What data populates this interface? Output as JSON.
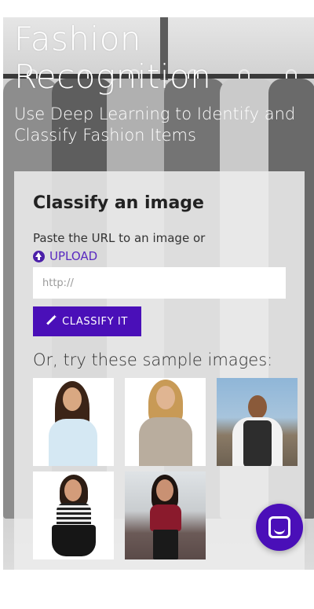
{
  "header": {
    "title": "Fashion Recognition",
    "subtitle": "Use Deep Learning to Identify and Classify Fashion Items"
  },
  "card": {
    "title": "Classify an image",
    "paste_text": "Paste the URL to an image or",
    "upload_label": "UPLOAD",
    "url_placeholder": "http://",
    "url_value": "",
    "classify_label": "CLASSIFY IT",
    "samples_heading": "Or, try these sample images:"
  },
  "samples": [
    {
      "name": "woman-white-wrap-top"
    },
    {
      "name": "woman-beige-sweater"
    },
    {
      "name": "man-vest-sunglasses"
    },
    {
      "name": "woman-striped-top-black-skirt"
    },
    {
      "name": "woman-red-top-black-pants"
    }
  ],
  "colors": {
    "accent": "#4a0fb8",
    "link": "#5a2ac0"
  },
  "icons": {
    "upload": "upload-circle-arrow-icon",
    "classify": "magic-wand-icon",
    "chat": "chat-bubble-icon"
  }
}
